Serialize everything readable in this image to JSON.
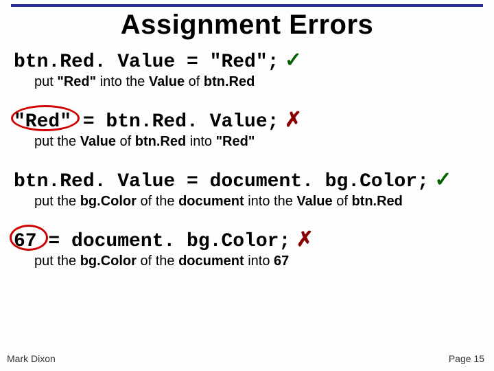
{
  "title": "Assignment Errors",
  "blocks": [
    {
      "code": "btn.Red. Value = \"Red\";",
      "mark": "✓",
      "explain_pre": "put ",
      "explain_b1": "\"Red\"",
      "explain_mid1": " into the ",
      "explain_b2": "Value",
      "explain_mid2": " of ",
      "explain_b3": "btn.Red",
      "explain_post": ""
    },
    {
      "code": "\"Red\" = btn.Red. Value;",
      "mark": "✗",
      "explain_pre": "put the ",
      "explain_b1": "Value",
      "explain_mid1": " of ",
      "explain_b2": "btn.Red",
      "explain_mid2": " into ",
      "explain_b3": "\"Red\"",
      "explain_post": ""
    },
    {
      "code": "btn.Red. Value = document. bg.Color;",
      "mark": "✓",
      "explain_pre": "put the ",
      "explain_b1": "bg.Color",
      "explain_mid1": " of the ",
      "explain_b2": "document",
      "explain_mid2": " into the ",
      "explain_b3": "Value",
      "explain_post_mid": " of ",
      "explain_b4": "btn.Red"
    },
    {
      "code": "67 = document. bg.Color;",
      "mark": "✗",
      "explain_pre": "put the ",
      "explain_b1": "bg.Color",
      "explain_mid1": " of the ",
      "explain_b2": "document",
      "explain_mid2": " into ",
      "explain_b3": "67",
      "explain_post": ""
    }
  ],
  "footer": {
    "left": "Mark Dixon",
    "right": "Page 15"
  }
}
